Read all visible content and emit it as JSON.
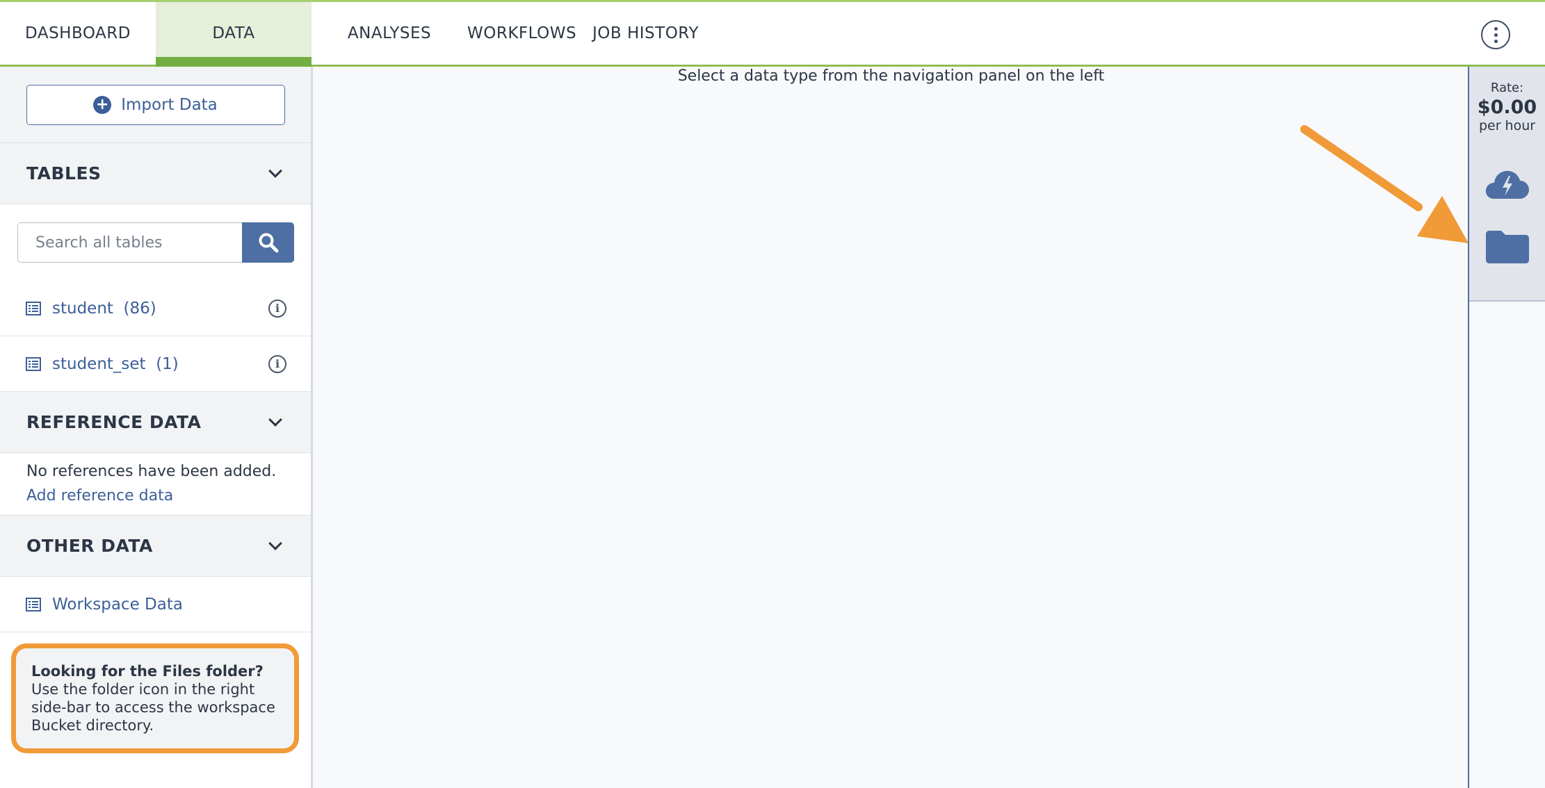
{
  "nav": {
    "tabs": [
      {
        "label": "DASHBOARD"
      },
      {
        "label": "DATA"
      },
      {
        "label": "ANALYSES"
      },
      {
        "label": "WORKFLOWS"
      },
      {
        "label": "JOB HISTORY"
      }
    ],
    "active_tab": "DATA",
    "accent_color": "#74ae43"
  },
  "left_panel": {
    "import_button": {
      "label": "Import Data",
      "icon": "plus-circle-icon"
    },
    "tables_section": {
      "title": "TABLES",
      "search": {
        "placeholder": "Search all tables",
        "value": ""
      },
      "items": [
        {
          "label": "student  (86)"
        },
        {
          "label": "student_set  (1)"
        }
      ]
    },
    "reference_section": {
      "title": "REFERENCE DATA",
      "empty_text": "No references have been added.",
      "add_link": "Add reference data"
    },
    "other_section": {
      "title": "OTHER DATA",
      "items": [
        {
          "label": "Workspace Data"
        }
      ]
    },
    "callout": {
      "title": "Looking for the Files folder?",
      "body": "Use the folder icon in the right side-bar to access the workspace Bucket directory.",
      "border_color": "#f19a38"
    }
  },
  "main": {
    "message": "Select a data type from the navigation panel on the left"
  },
  "right_rail": {
    "rate_label": "Rate:",
    "rate_value": "$0.00",
    "rate_unit": "per hour",
    "icons": [
      "cloud-lightning-icon",
      "folder-icon"
    ],
    "icon_color": "#4d6fa3"
  },
  "annotation": {
    "arrow_color": "#f19a38"
  }
}
